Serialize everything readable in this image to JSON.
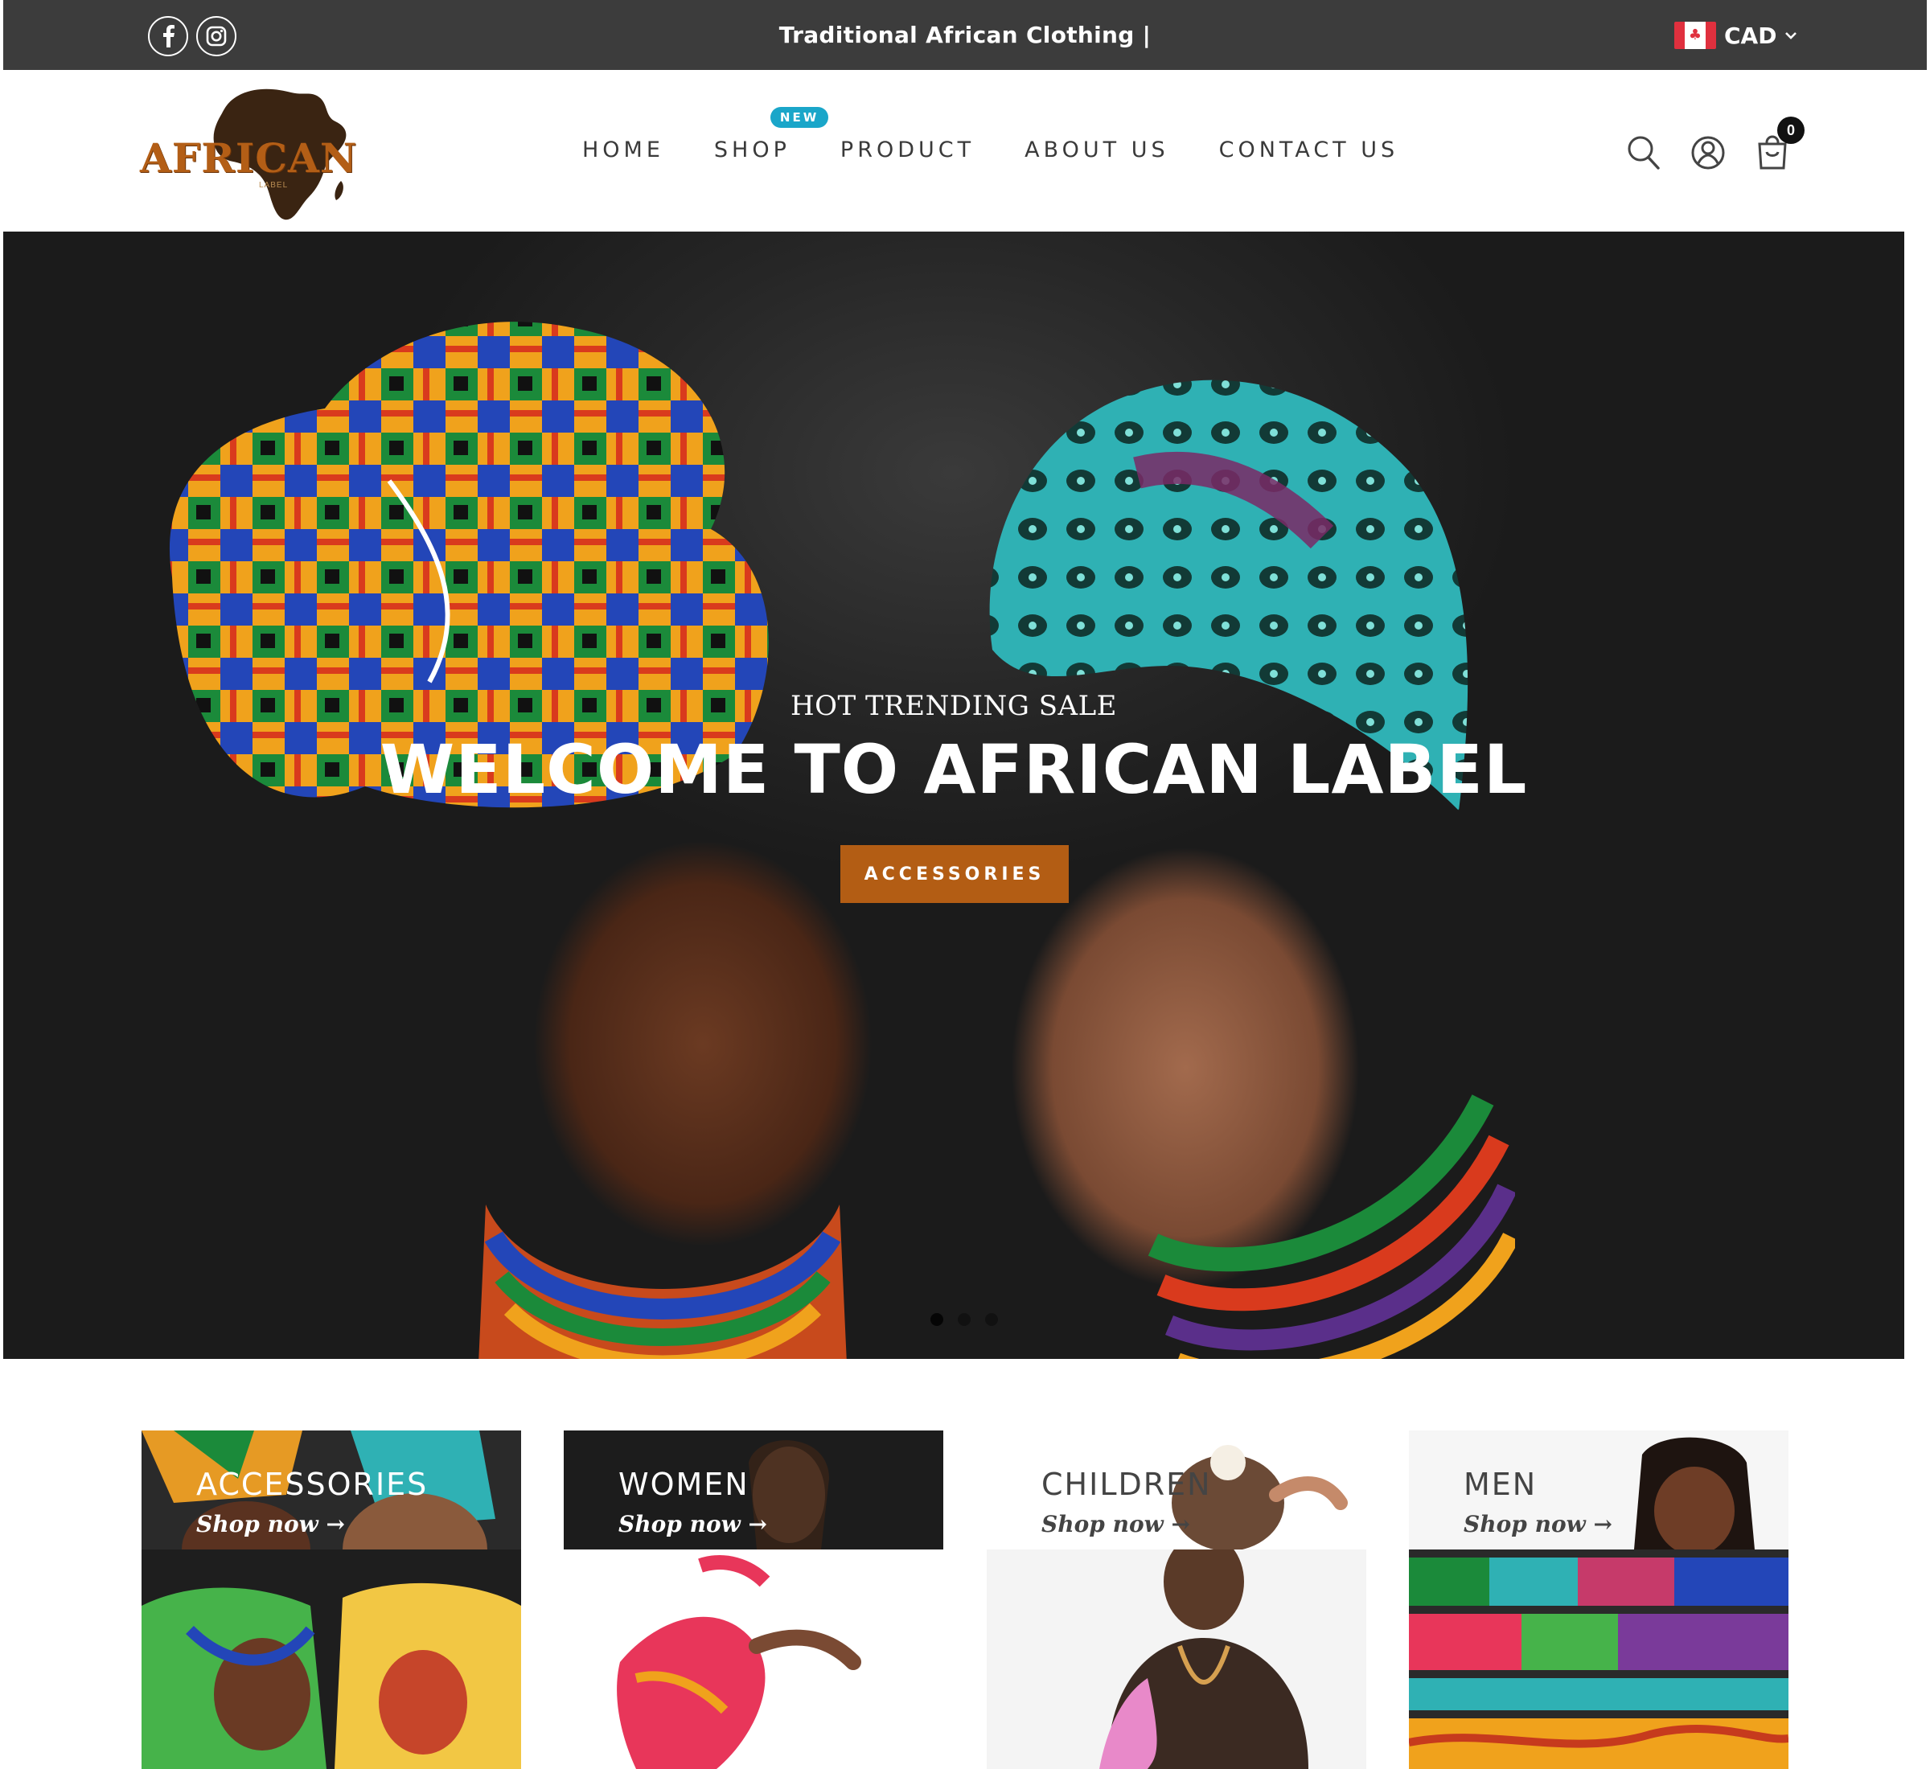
{
  "topbar": {
    "social": [
      {
        "name": "facebook-icon"
      },
      {
        "name": "instagram-icon"
      }
    ],
    "announcement": "Traditional African Clothing |",
    "currency": "CAD",
    "currency_flag": "canada-flag-icon"
  },
  "header": {
    "logo_text": "AFRICAN",
    "logo_subtext": "LABEL",
    "nav": [
      {
        "label": "HOME"
      },
      {
        "label": "SHOP",
        "badge": "NEW"
      },
      {
        "label": "PRODUCT"
      },
      {
        "label": "ABOUT US"
      },
      {
        "label": "CONTACT US"
      }
    ],
    "cart_count": "0"
  },
  "hero": {
    "subtitle": "HOT TRENDING SALE",
    "title": "WELCOME TO AFRICAN LABEL",
    "button_label": "ACCESSORIES",
    "slide_count": 3,
    "active_slide": 1
  },
  "categories": [
    {
      "title": "ACCESSORIES",
      "link": "Shop now →"
    },
    {
      "title": "WOMEN",
      "link": "Shop now →"
    },
    {
      "title": "CHILDREN",
      "link": "Shop now →"
    },
    {
      "title": "MEN",
      "link": "Shop now →"
    }
  ],
  "colors": {
    "topbar_bg": "#3c3c3c",
    "accent": "#b35d14",
    "badge": "#1aa6c9",
    "brand": "#b35e16"
  }
}
